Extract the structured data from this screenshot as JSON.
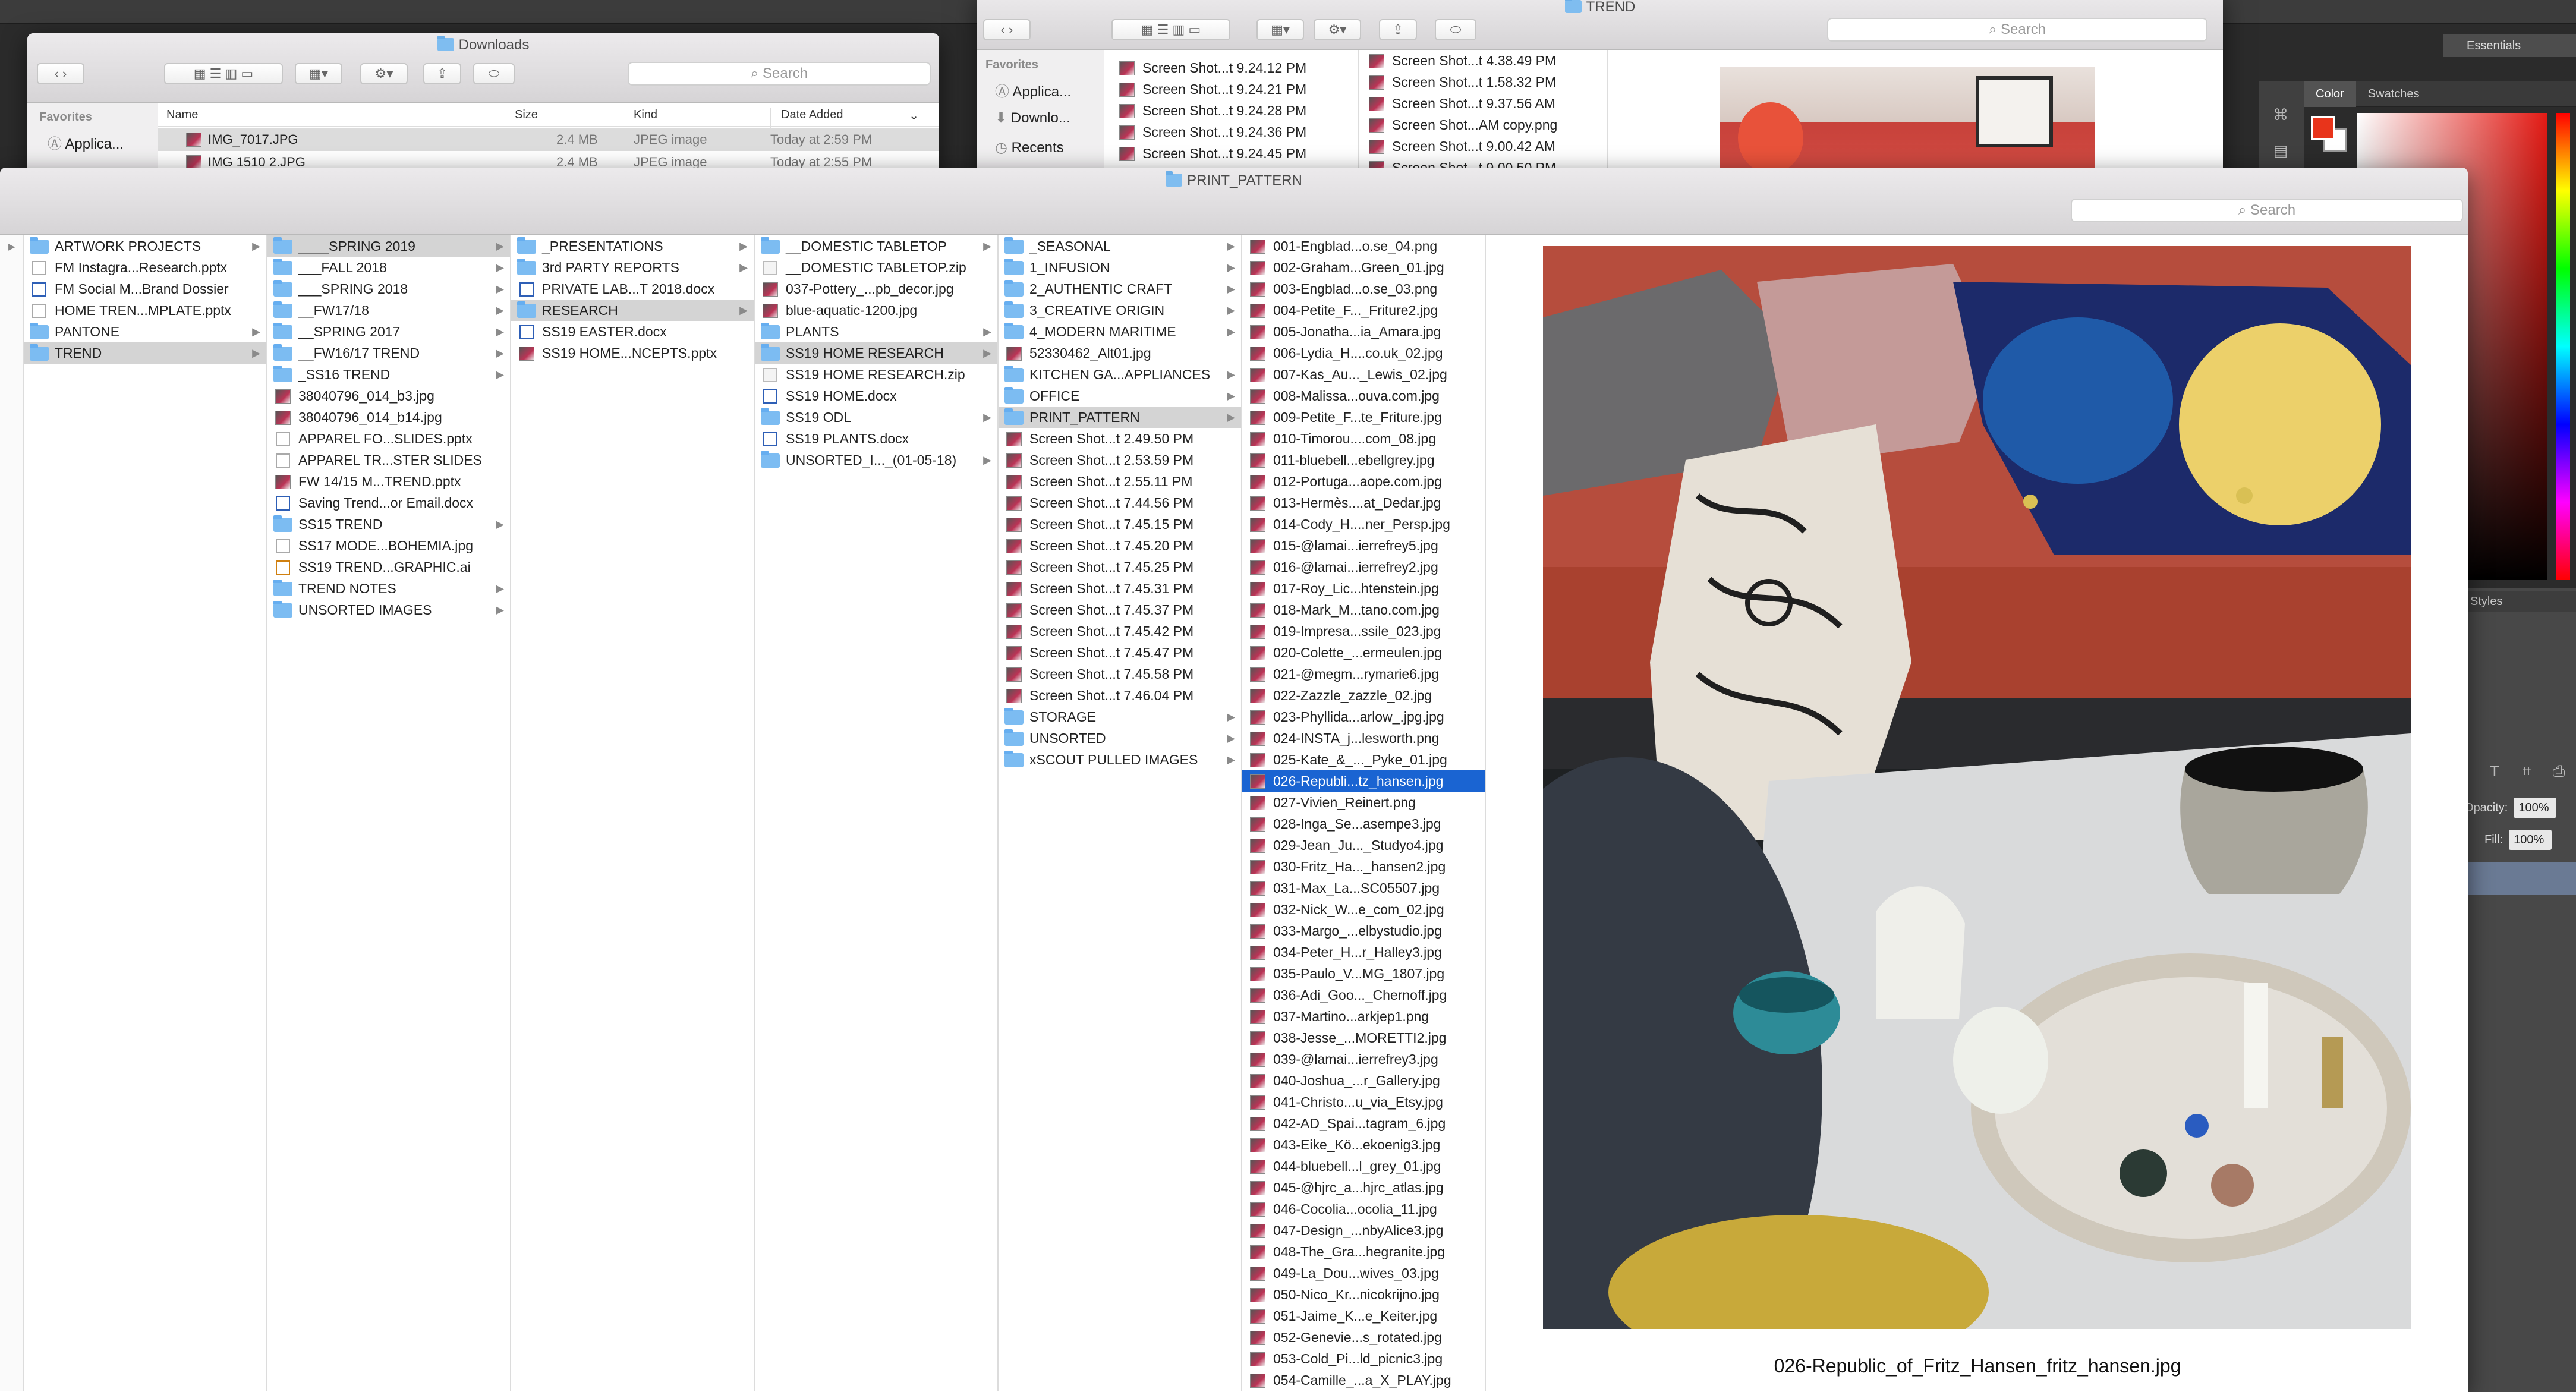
{
  "photoshop": {
    "workspace": "Essentials",
    "panel_tabs": [
      "Color",
      "Swatches"
    ],
    "styles_label": "Styles",
    "opacity_label": "Opacity:",
    "opacity_value": "100%",
    "fill_label": "Fill:",
    "fill_value": "100%",
    "colors": {
      "foreground": "#e8341b",
      "background": "#ffffff"
    }
  },
  "downloads_window": {
    "title": "Downloads",
    "search_placeholder": "Search",
    "sidebar_header": "Favorites",
    "sidebar_items": [
      "Applica..."
    ],
    "columns": [
      "Name",
      "Size",
      "Kind",
      "Date Added"
    ],
    "rows": [
      {
        "name": "IMG_7017.JPG",
        "size": "2.4 MB",
        "kind": "JPEG image",
        "date": "Today at 2:59 PM"
      },
      {
        "name": "IMG 1510 2.JPG",
        "size": "2.4 MB",
        "kind": "JPEG image",
        "date": "Today at 2:55 PM"
      }
    ]
  },
  "trend_window": {
    "title": "TREND",
    "search_placeholder": "Search",
    "sidebar_header": "Favorites",
    "sidebar_items": [
      "Applica...",
      "Downlo...",
      "Recents"
    ],
    "col1": [
      "Screen Shot...t 9.24.12 PM",
      "Screen Shot...t 9.24.21 PM",
      "Screen Shot...t 9.24.28 PM",
      "Screen Shot...t 9.24.36 PM",
      "Screen Shot...t 9.24.45 PM"
    ],
    "col2": [
      "Screen Shot...t 4.38.49 PM",
      "Screen Shot...t 1.58.32 PM",
      "Screen Shot...t 9.37.56 AM",
      "Screen Shot...AM copy.png",
      "Screen Shot...t 9.00.42 AM",
      "Screen Shot...t 9.00.50 PM"
    ]
  },
  "main_window": {
    "title": "PRINT_PATTERN",
    "search_placeholder": "Search",
    "columns": [
      {
        "items": [
          {
            "label": "ARTWORK PROJECTS",
            "icon": "folder",
            "chev": true
          },
          {
            "label": "FM Instagra...Research.pptx",
            "icon": "ppt"
          },
          {
            "label": "FM Social M...Brand Dossier",
            "icon": "doc"
          },
          {
            "label": "HOME TREN...MPLATE.pptx",
            "icon": "ppt"
          },
          {
            "label": "PANTONE",
            "icon": "folder",
            "chev": true
          },
          {
            "label": "TREND",
            "icon": "folder",
            "chev": true,
            "sel": "gray"
          }
        ]
      },
      {
        "items": [
          {
            "label": "____SPRING 2019",
            "icon": "folder",
            "chev": true,
            "sel": "gray"
          },
          {
            "label": "___FALL 2018",
            "icon": "folder",
            "chev": true
          },
          {
            "label": "___SPRING 2018",
            "icon": "folder",
            "chev": true
          },
          {
            "label": "__FW17/18",
            "icon": "folder",
            "chev": true
          },
          {
            "label": "__SPRING 2017",
            "icon": "folder",
            "chev": true
          },
          {
            "label": "__FW16/17 TREND",
            "icon": "folder",
            "chev": true
          },
          {
            "label": "_SS16 TREND",
            "icon": "folder",
            "chev": true
          },
          {
            "label": "38040796_014_b3.jpg",
            "icon": "img"
          },
          {
            "label": "38040796_014_b14.jpg",
            "icon": "img"
          },
          {
            "label": "APPAREL FO...SLIDES.pptx",
            "icon": "ppt"
          },
          {
            "label": "APPAREL TR...STER SLIDES",
            "icon": "ppt"
          },
          {
            "label": "FW 14/15 M...TREND.pptx",
            "icon": "img"
          },
          {
            "label": "Saving Trend...or Email.docx",
            "icon": "doc"
          },
          {
            "label": "SS15 TREND",
            "icon": "folder",
            "chev": true
          },
          {
            "label": "SS17 MODE...BOHEMIA.jpg",
            "icon": "ppt"
          },
          {
            "label": "SS19 TREND...GRAPHIC.ai",
            "icon": "ai"
          },
          {
            "label": "TREND NOTES",
            "icon": "folder",
            "chev": true
          },
          {
            "label": "UNSORTED IMAGES",
            "icon": "folder",
            "chev": true
          }
        ]
      },
      {
        "items": [
          {
            "label": "_PRESENTATIONS",
            "icon": "folder",
            "chev": true
          },
          {
            "label": "3rd PARTY REPORTS",
            "icon": "folder",
            "chev": true
          },
          {
            "label": "PRIVATE LAB...T 2018.docx",
            "icon": "doc"
          },
          {
            "label": "RESEARCH",
            "icon": "folder",
            "chev": true,
            "sel": "gray"
          },
          {
            "label": "SS19 EASTER.docx",
            "icon": "doc"
          },
          {
            "label": "SS19 HOME...NCEPTS.pptx",
            "icon": "img"
          }
        ]
      },
      {
        "items": [
          {
            "label": "__DOMESTIC TABLETOP",
            "icon": "folder",
            "chev": true
          },
          {
            "label": "__DOMESTIC TABLETOP.zip",
            "icon": "zip"
          },
          {
            "label": "037-Pottery_...pb_decor.jpg",
            "icon": "img"
          },
          {
            "label": "blue-aquatic-1200.jpg",
            "icon": "img"
          },
          {
            "label": "PLANTS",
            "icon": "folder",
            "chev": true
          },
          {
            "label": "SS19 HOME RESEARCH",
            "icon": "folder",
            "chev": true,
            "sel": "gray"
          },
          {
            "label": "SS19 HOME RESEARCH.zip",
            "icon": "zip"
          },
          {
            "label": "SS19 HOME.docx",
            "icon": "doc"
          },
          {
            "label": "SS19 ODL",
            "icon": "folder",
            "chev": true
          },
          {
            "label": "SS19 PLANTS.docx",
            "icon": "doc"
          },
          {
            "label": "UNSORTED_I..._(01-05-18)",
            "icon": "folder",
            "chev": true
          }
        ]
      },
      {
        "items": [
          {
            "label": "_SEASONAL",
            "icon": "folder",
            "chev": true
          },
          {
            "label": "1_INFUSION",
            "icon": "folder",
            "chev": true
          },
          {
            "label": "2_AUTHENTIC CRAFT",
            "icon": "folder",
            "chev": true
          },
          {
            "label": "3_CREATIVE ORIGIN",
            "icon": "folder",
            "chev": true
          },
          {
            "label": "4_MODERN MARITIME",
            "icon": "folder",
            "chev": true
          },
          {
            "label": "52330462_Alt01.jpg",
            "icon": "img"
          },
          {
            "label": "KITCHEN GA...APPLIANCES",
            "icon": "folder",
            "chev": true
          },
          {
            "label": "OFFICE",
            "icon": "folder",
            "chev": true
          },
          {
            "label": "PRINT_PATTERN",
            "icon": "folder",
            "chev": true,
            "sel": "gray"
          },
          {
            "label": "Screen Shot...t 2.49.50 PM",
            "icon": "img"
          },
          {
            "label": "Screen Shot...t 2.53.59 PM",
            "icon": "img"
          },
          {
            "label": "Screen Shot...t 2.55.11 PM",
            "icon": "img"
          },
          {
            "label": "Screen Shot...t 7.44.56 PM",
            "icon": "img"
          },
          {
            "label": "Screen Shot...t 7.45.15 PM",
            "icon": "img"
          },
          {
            "label": "Screen Shot...t 7.45.20 PM",
            "icon": "img"
          },
          {
            "label": "Screen Shot...t 7.45.25 PM",
            "icon": "img"
          },
          {
            "label": "Screen Shot...t 7.45.31 PM",
            "icon": "img"
          },
          {
            "label": "Screen Shot...t 7.45.37 PM",
            "icon": "img"
          },
          {
            "label": "Screen Shot...t 7.45.42 PM",
            "icon": "img"
          },
          {
            "label": "Screen Shot...t 7.45.47 PM",
            "icon": "img"
          },
          {
            "label": "Screen Shot...t 7.45.58 PM",
            "icon": "img"
          },
          {
            "label": "Screen Shot...t 7.46.04 PM",
            "icon": "img"
          },
          {
            "label": "STORAGE",
            "icon": "folder",
            "chev": true
          },
          {
            "label": "UNSORTED",
            "icon": "folder",
            "chev": true
          },
          {
            "label": "xSCOUT PULLED IMAGES",
            "icon": "folder",
            "chev": true
          }
        ]
      },
      {
        "items": [
          {
            "label": "001-Engblad...o.se_04.png",
            "icon": "img"
          },
          {
            "label": "002-Graham...Green_01.jpg",
            "icon": "img"
          },
          {
            "label": "003-Engblad...o.se_03.png",
            "icon": "img"
          },
          {
            "label": "004-Petite_F..._Friture2.jpg",
            "icon": "img"
          },
          {
            "label": "005-Jonatha...ia_Amara.jpg",
            "icon": "img"
          },
          {
            "label": "006-Lydia_H....co.uk_02.jpg",
            "icon": "img"
          },
          {
            "label": "007-Kas_Au..._Lewis_02.jpg",
            "icon": "img"
          },
          {
            "label": "008-Malissa...ouva.com.jpg",
            "icon": "img"
          },
          {
            "label": "009-Petite_F...te_Friture.jpg",
            "icon": "img"
          },
          {
            "label": "010-Timorou....com_08.jpg",
            "icon": "img"
          },
          {
            "label": "011-bluebell...ebellgrey.jpg",
            "icon": "img"
          },
          {
            "label": "012-Portuga...aope.com.jpg",
            "icon": "img"
          },
          {
            "label": "013-Hermès....at_Dedar.jpg",
            "icon": "img"
          },
          {
            "label": "014-Cody_H....ner_Persp.jpg",
            "icon": "img"
          },
          {
            "label": "015-@lamai...ierrefrey5.jpg",
            "icon": "img"
          },
          {
            "label": "016-@lamai...ierrefrey2.jpg",
            "icon": "img"
          },
          {
            "label": "017-Roy_Lic...htenstein.jpg",
            "icon": "img"
          },
          {
            "label": "018-Mark_M...tano.com.jpg",
            "icon": "img"
          },
          {
            "label": "019-Impresa...ssile_023.jpg",
            "icon": "img"
          },
          {
            "label": "020-Colette_...ermeulen.jpg",
            "icon": "img"
          },
          {
            "label": "021-@megm...rymarie6.jpg",
            "icon": "img"
          },
          {
            "label": "022-Zazzle_zazzle_02.jpg",
            "icon": "img"
          },
          {
            "label": "023-Phyllida...arlow_.jpg.jpg",
            "icon": "img"
          },
          {
            "label": "024-INSTA_j...lesworth.png",
            "icon": "img"
          },
          {
            "label": "025-Kate_&_..._Pyke_01.jpg",
            "icon": "img"
          },
          {
            "label": "026-Republi...tz_hansen.jpg",
            "icon": "img",
            "sel": "blue"
          },
          {
            "label": "027-Vivien_Reinert.png",
            "icon": "img"
          },
          {
            "label": "028-Inga_Se...asempe3.jpg",
            "icon": "img"
          },
          {
            "label": "029-Jean_Ju..._Studyo4.jpg",
            "icon": "img"
          },
          {
            "label": "030-Fritz_Ha..._hansen2.jpg",
            "icon": "img"
          },
          {
            "label": "031-Max_La...SC05507.jpg",
            "icon": "img"
          },
          {
            "label": "032-Nick_W...e_com_02.jpg",
            "icon": "img"
          },
          {
            "label": "033-Margo_...elbystudio.jpg",
            "icon": "img"
          },
          {
            "label": "034-Peter_H...r_Halley3.jpg",
            "icon": "img"
          },
          {
            "label": "035-Paulo_V...MG_1807.jpg",
            "icon": "img"
          },
          {
            "label": "036-Adi_Goo..._Chernoff.jpg",
            "icon": "img"
          },
          {
            "label": "037-Martino...arkjep1.png",
            "icon": "img"
          },
          {
            "label": "038-Jesse_...MORETTI2.jpg",
            "icon": "img"
          },
          {
            "label": "039-@lamai...ierrefrey3.jpg",
            "icon": "img"
          },
          {
            "label": "040-Joshua_...r_Gallery.jpg",
            "icon": "img"
          },
          {
            "label": "041-Christo...u_via_Etsy.jpg",
            "icon": "img"
          },
          {
            "label": "042-AD_Spai...tagram_6.jpg",
            "icon": "img"
          },
          {
            "label": "043-Eike_Kö...ekoenig3.jpg",
            "icon": "img"
          },
          {
            "label": "044-bluebell...l_grey_01.jpg",
            "icon": "img"
          },
          {
            "label": "045-@hjrc_a...hjrc_atlas.jpg",
            "icon": "img"
          },
          {
            "label": "046-Cocolia...ocolia_11.jpg",
            "icon": "img"
          },
          {
            "label": "047-Design_...nbyAlice3.jpg",
            "icon": "img"
          },
          {
            "label": "048-The_Gra...hegranite.jpg",
            "icon": "img"
          },
          {
            "label": "049-La_Dou...wives_03.jpg",
            "icon": "img"
          },
          {
            "label": "050-Nico_Kr...nicokrijno.jpg",
            "icon": "img"
          },
          {
            "label": "051-Jaime_K...e_Keiter.jpg",
            "icon": "img"
          },
          {
            "label": "052-Genevie...s_rotated.jpg",
            "icon": "img"
          },
          {
            "label": "053-Cold_Pi...ld_picnic3.jpg",
            "icon": "img"
          },
          {
            "label": "054-Camille_...a_X_PLAY.jpg",
            "icon": "img"
          }
        ]
      }
    ],
    "preview": {
      "filename": "026-Republic_of_Fritz_Hansen_fritz_hansen.jpg"
    }
  }
}
